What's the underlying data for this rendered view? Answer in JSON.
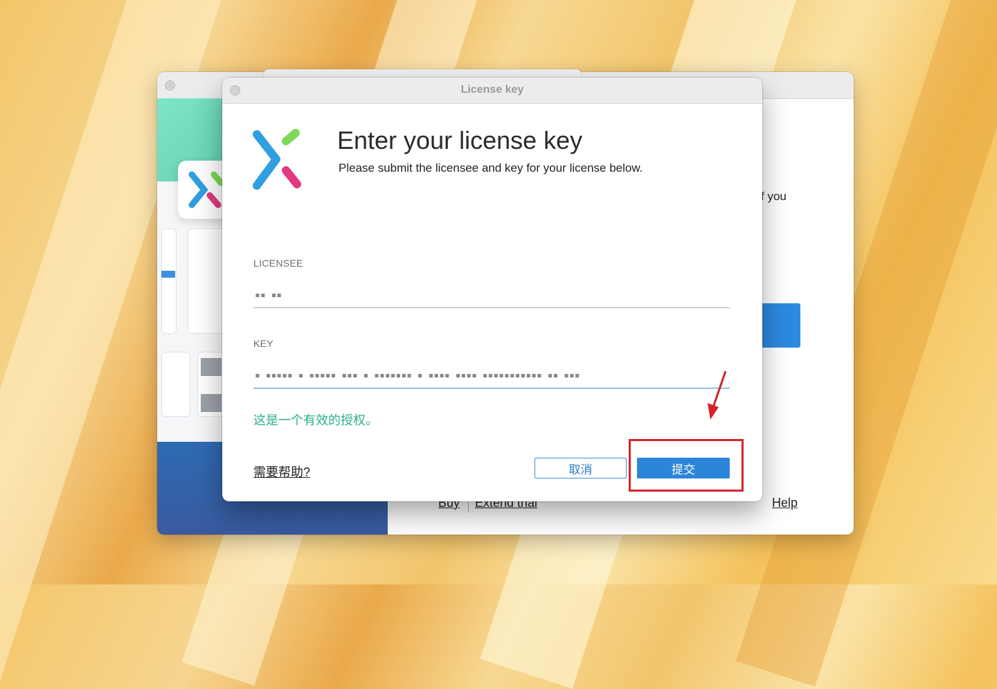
{
  "background_window": {
    "partial_text": "f you",
    "links": {
      "buy": "Buy",
      "extend_trial": "Extend trial",
      "help": "Help"
    }
  },
  "dialog": {
    "title": "License key",
    "heading": "Enter your license key",
    "subheading": "Please submit the licensee and key for your license below.",
    "licensee": {
      "label": "LICENSEE",
      "value": "▪▪ ▪▪"
    },
    "key": {
      "label": "KEY",
      "value": "▪ ▪▪▪▪▪ ▪ ▪▪▪▪▪ ▪▪▪ ▪ ▪▪▪▪▪▪▪ ▪ ▪▪▪▪ ▪▪▪▪ ▪▪▪▪▪▪▪▪▪▪▪ ▪▪ ▪▪▪"
    },
    "valid_message": "这是一个有效的授权。",
    "help_link": "需要帮助?",
    "cancel_label": "取消",
    "submit_label": "提交"
  },
  "colors": {
    "accent": "#2b86d9",
    "valid_text": "#2bb08a",
    "highlight": "#d6232a",
    "logo_blue": "#2f9fe0",
    "logo_green": "#7ed957",
    "logo_pink": "#e2387f"
  }
}
